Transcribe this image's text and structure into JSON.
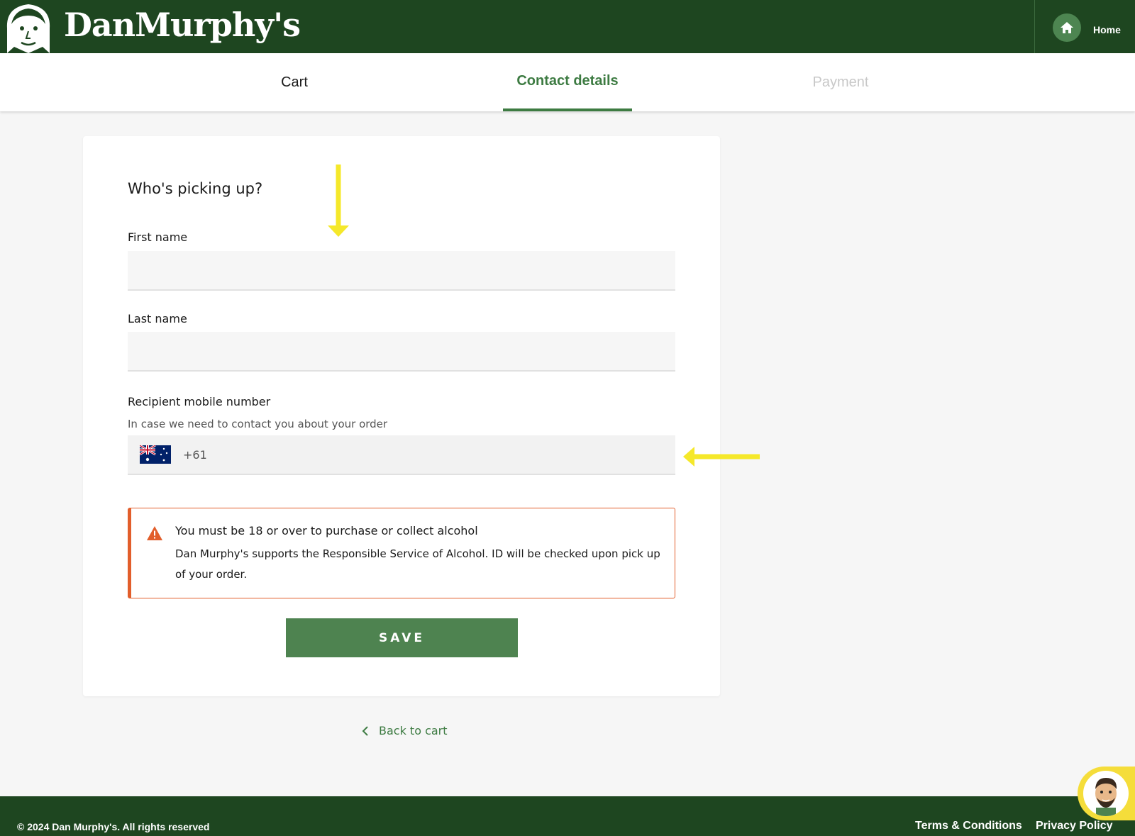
{
  "header": {
    "brand": "DanMurphy's",
    "home_label": "Home"
  },
  "steps": [
    {
      "label": "Cart",
      "state": "done"
    },
    {
      "label": "Contact details",
      "state": "active"
    },
    {
      "label": "Payment",
      "state": "disabled"
    }
  ],
  "form": {
    "title": "Who's picking up?",
    "first_name_label": "First name",
    "first_name_value": "",
    "last_name_label": "Last name",
    "last_name_value": "",
    "mobile_label": "Recipient mobile number",
    "mobile_help": "In case we need to contact you about your order",
    "country_code": "+61",
    "country_flag": "australia-flag-icon"
  },
  "warning": {
    "title": "You must be 18 or over to purchase or collect alcohol",
    "body": "Dan Murphy's supports the Responsible Service of Alcohol. ID will be checked upon pick up of your order.",
    "color": "#e25e2b"
  },
  "save_label": "SAVE",
  "back_label": "Back to cart",
  "footer": {
    "copyright": "© 2024 Dan Murphy's. All rights reserved",
    "terms": "Terms & Conditions",
    "privacy": "Privacy Policy"
  },
  "colors": {
    "brand_green": "#1e4620",
    "accent_green": "#3d7b42",
    "button_green": "#4e8350",
    "annotation_yellow": "#f5e82a"
  }
}
